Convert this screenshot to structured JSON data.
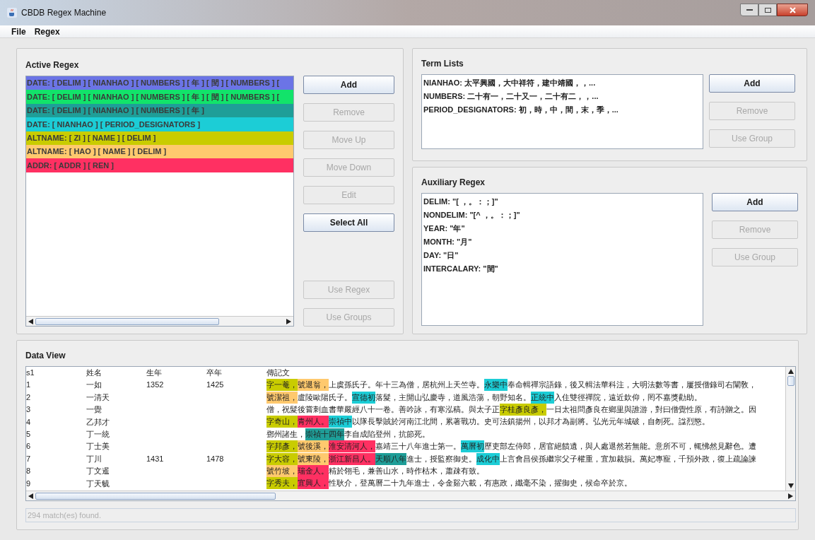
{
  "window": {
    "title": "CBDB Regex Machine"
  },
  "menu": [
    "File",
    "Regex"
  ],
  "active_regex": {
    "title": "Active Regex",
    "items": [
      {
        "text": "DATE: [ DELIM ] [ NIANHAO ] [ NUMBERS ] [ 年 ] [ 閏 ] [ NUMBERS ] [",
        "color": "#6b74e6"
      },
      {
        "text": "DATE: [ DELIM ] [ NIANHAO ] [ NUMBERS ] [ 年 ] [ 閏 ] [ NUMBERS ] [",
        "color": "#12e36a"
      },
      {
        "text": "DATE: [ DELIM ] [ NIANHAO ] [ NUMBERS ] [ 年 ]",
        "color": "#1f9e98"
      },
      {
        "text": "DATE: [ NIANHAO ] [ PERIOD_DESIGNATORS ]",
        "color": "#1ccdd6"
      },
      {
        "text": "ALTNAME: [ ZI ] [ NAME ] [ DELIM ]",
        "color": "#c9cc00"
      },
      {
        "text": "ALTNAME: [ HAO ] [ NAME ] [ DELIM ]",
        "color": "#ffc96e"
      },
      {
        "text": "ADDR: [ ADDR ] [ REN ]",
        "color": "#ff3062"
      }
    ],
    "buttons": [
      {
        "label": "Add",
        "disabled": false
      },
      {
        "label": "Remove",
        "disabled": true
      },
      {
        "label": "Move Up",
        "disabled": true
      },
      {
        "label": "Move Down",
        "disabled": true
      },
      {
        "label": "Edit",
        "disabled": true
      },
      {
        "label": "Select All",
        "disabled": false
      }
    ],
    "bottom_buttons": [
      {
        "label": "Use Regex",
        "disabled": true
      },
      {
        "label": "Use Groups",
        "disabled": true
      }
    ]
  },
  "term_lists": {
    "title": "Term Lists",
    "items": [
      "NIANHAO: 太平興國，大中祥符，建中靖國，，...",
      "NUMBERS: 二十有一，二十又一，二十有二，，...",
      "PERIOD_DESIGNATORS: 初，時，中，間，末，季，..."
    ],
    "buttons": [
      {
        "label": "Add",
        "disabled": false
      },
      {
        "label": "Remove",
        "disabled": true
      },
      {
        "label": "Use Group",
        "disabled": true
      }
    ]
  },
  "auxiliary_regex": {
    "title": "Auxiliary Regex",
    "items": [
      "DELIM: \"[ ，。：；]\"",
      "NONDELIM: \"[^ ，。：；]\"",
      "YEAR: \"年\"",
      "MONTH: \"月\"",
      "DAY: \"日\"",
      "INTERCALARY: \"閏\""
    ],
    "buttons": [
      {
        "label": "Add",
        "disabled": false
      },
      {
        "label": "Remove",
        "disabled": true
      },
      {
        "label": "Use Group",
        "disabled": true
      }
    ]
  },
  "data_view": {
    "title": "Data View",
    "columns": [
      "s1",
      "姓名",
      "生年",
      "卒年",
      "傳記文"
    ],
    "rows": [
      {
        "cells": [
          "1",
          "一如",
          "1352",
          "1425"
        ],
        "bio": [
          {
            "text": "字一菴，",
            "color": "#c9cc00"
          },
          {
            "text": "號退翁，",
            "color": "#ffc96e"
          },
          {
            "text": "上虞孫氏子。年十三為僧，居杭州上天竺寺。"
          },
          {
            "text": "永樂中",
            "color": "#1ccdd6"
          },
          {
            "text": "奉命輯禪宗語錄，後又輯法華科注，大明法數等書，屢授僧錄司右闡敎，"
          }
        ]
      },
      {
        "cells": [
          "2",
          "一清天",
          "",
          ""
        ],
        "bio": [
          {
            "text": "號潔祖，",
            "color": "#ffc96e"
          },
          {
            "text": "盧陵歐陽氏子。"
          },
          {
            "text": "宣德初",
            "color": "#1ccdd6"
          },
          {
            "text": "落髮，主開山弘慶寺，道風浩蕩，朝野知名。"
          },
          {
            "text": "正統中",
            "color": "#1ccdd6"
          },
          {
            "text": "入住雙徑禪院，遠近欽仰，罔不嘉獎勸助。"
          }
        ]
      },
      {
        "cells": [
          "3",
          "一覺",
          "",
          ""
        ],
        "bio": [
          {
            "text": "僧，祝髮後嘗刺血書華嚴經八十一卷。善吟詠，有寒泓稿。與太子正"
          },
          {
            "text": "字桂彥良彥，",
            "color": "#c9cc00"
          },
          {
            "text": "一日太祖問彥良在鄉里與誰游，對曰僧覺性原，有詩贈之。因"
          }
        ]
      },
      {
        "cells": [
          "4",
          "乙邦才",
          "",
          ""
        ],
        "bio": [
          {
            "text": "字奇山，",
            "color": "#c9cc00"
          },
          {
            "text": "青州人。",
            "color": "#ff3062"
          },
          {
            "text": "崇禎中",
            "color": "#1ccdd6"
          },
          {
            "text": "以隊長擊賊於河南江北間，累著戰功。史可法鎮揚州，以邦才為副將。弘光元年城破，自刎死。諡烈愍。"
          }
        ]
      },
      {
        "cells": [
          "5",
          "丁一統",
          "",
          ""
        ],
        "bio": [
          {
            "text": "鄧州諸生，"
          },
          {
            "text": "崇禎十四年",
            "color": "#1f9e98"
          },
          {
            "text": "李自成陷登州，抗節死。"
          }
        ]
      },
      {
        "cells": [
          "6",
          "丁士美",
          "",
          ""
        ],
        "bio": [
          {
            "text": "字邦彥，",
            "color": "#c9cc00"
          },
          {
            "text": "號後溪，",
            "color": "#ffc96e"
          },
          {
            "text": "淮安清河人，",
            "color": "#ff3062"
          },
          {
            "text": "嘉靖三十八年進士第一。"
          },
          {
            "text": "萬曆初",
            "color": "#1ccdd6"
          },
          {
            "text": "歷吏部左侍郎，居官絕饋遺，與人處退然若無能。意所不可，輒怫然見辭色。遭"
          }
        ]
      },
      {
        "cells": [
          "7",
          "丁川",
          "1431",
          "1478"
        ],
        "bio": [
          {
            "text": "字大容，",
            "color": "#c9cc00"
          },
          {
            "text": "號東陵，",
            "color": "#ffc96e"
          },
          {
            "text": "浙江新昌人。",
            "color": "#ff3062"
          },
          {
            "text": "天順八年",
            "color": "#1f9e98"
          },
          {
            "text": "進士，授監察御史。"
          },
          {
            "text": "成化中",
            "color": "#1ccdd6"
          },
          {
            "text": "上言會昌侯孫繼宗父子權重，宜加裁損。萬妃專寵，千預外政，復上疏論諫"
          }
        ]
      },
      {
        "cells": [
          "8",
          "丁文暹",
          "",
          ""
        ],
        "bio": [
          {
            "text": "號竹坡，",
            "color": "#ffc96e"
          },
          {
            "text": "瑞金人。",
            "color": "#ff3062"
          },
          {
            "text": "精於翎毛，兼善山水，時作枯木，蕭疎有致。"
          }
        ]
      },
      {
        "cells": [
          "9",
          "丁天毓",
          "",
          ""
        ],
        "bio": [
          {
            "text": "字秀夫，",
            "color": "#c9cc00"
          },
          {
            "text": "宜興人，",
            "color": "#ff3062"
          },
          {
            "text": "性耿介，登萬曆二十九年進士，令金谿六載，有惠政，纖毫不染，擢御史，候命卒於京。"
          }
        ]
      }
    ],
    "status": "294 match(es) found."
  }
}
